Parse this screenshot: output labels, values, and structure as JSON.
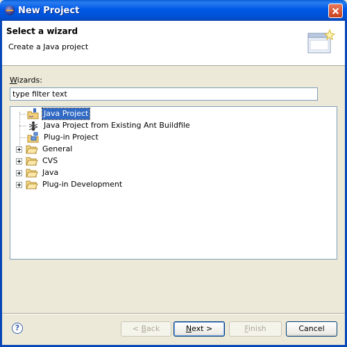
{
  "window": {
    "title": "New Project"
  },
  "header": {
    "title": "Select a wizard",
    "description": "Create a Java project"
  },
  "wizards": {
    "label_accel": "W",
    "label_rest": "izards:",
    "filter_value": "type filter text",
    "items": [
      {
        "label": "Java Project",
        "icon": "java-project-icon",
        "selected": true
      },
      {
        "label": "Java Project from Existing Ant Buildfile",
        "icon": "ant-icon"
      },
      {
        "label": "Plug-in Project",
        "icon": "plugin-project-icon"
      },
      {
        "label": "General",
        "icon": "folder-icon",
        "expandable": true
      },
      {
        "label": "CVS",
        "icon": "folder-icon",
        "expandable": true
      },
      {
        "label": "Java",
        "icon": "folder-icon",
        "expandable": true
      },
      {
        "label": "Plug-in Development",
        "icon": "folder-icon",
        "expandable": true
      }
    ]
  },
  "buttons": {
    "help": "?",
    "back_pre": "< ",
    "back_accel": "B",
    "back_rest": "ack",
    "next_accel": "N",
    "next_rest": "ext >",
    "finish_accel": "F",
    "finish_rest": "inish",
    "cancel": "Cancel"
  },
  "colors": {
    "title_bar": "#0058e6",
    "selection": "#316ac5",
    "dialog": "#ece9d8"
  }
}
